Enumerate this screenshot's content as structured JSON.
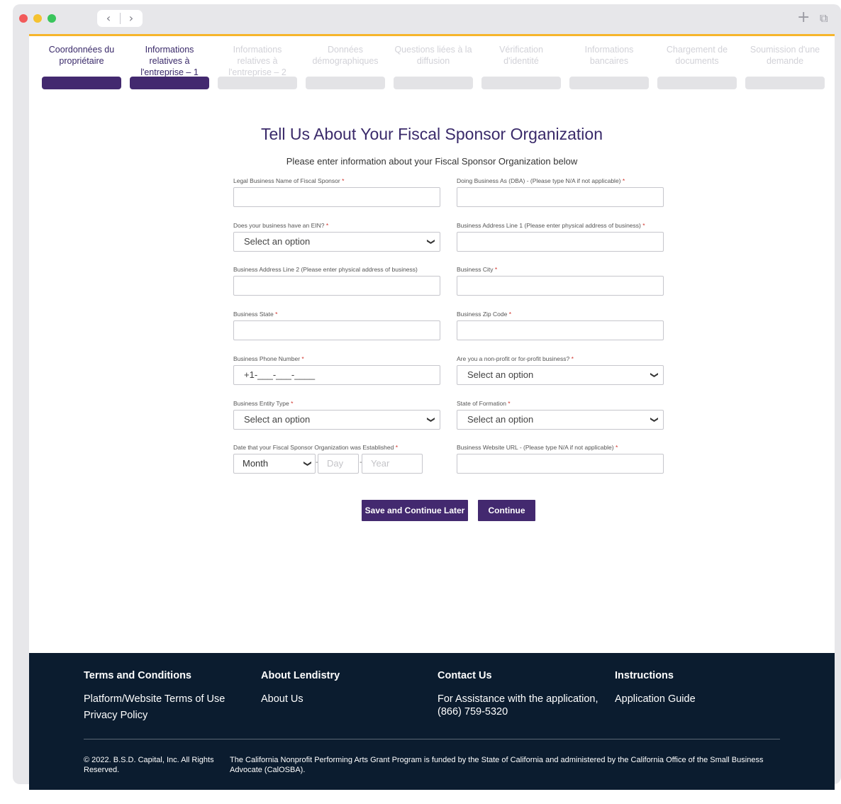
{
  "window": {
    "back_icon": "chevron-left-icon",
    "forward_icon": "chevron-right-icon",
    "new_tab_icon": "plus-icon",
    "tabs_icon": "tabs-overview-icon",
    "back_glyph": "‹",
    "forward_glyph": "›",
    "plus_glyph": "+",
    "tabs_glyph": "⧉"
  },
  "colors": {
    "accent": "#43296f",
    "progress_inactive": "#e3e3e6",
    "top_line": "#f6b52b",
    "footer_bg": "#0b1c2f",
    "required": "#d0342c"
  },
  "steps": [
    {
      "label": "Coordonnées du propriétaire",
      "active": true
    },
    {
      "label": "Informations relatives à l'entreprise – 1",
      "active": true
    },
    {
      "label": "Informations relatives à l'entreprise – 2",
      "active": false
    },
    {
      "label": "Données démographiques",
      "active": false
    },
    {
      "label": "Questions liées à la diffusion",
      "active": false
    },
    {
      "label": "Vérification d'identité",
      "active": false
    },
    {
      "label": "Informations bancaires",
      "active": false
    },
    {
      "label": "Chargement de documents",
      "active": false
    },
    {
      "label": "Soumission d'une demande",
      "active": false
    }
  ],
  "form": {
    "title": "Tell Us About Your Fiscal Sponsor Organization",
    "subtitle": "Please enter information about your Fiscal Sponsor Organization below",
    "required_marker": "*",
    "legal_name": {
      "label": "Legal Business Name of Fiscal Sponsor",
      "value": ""
    },
    "dba": {
      "label": "Doing Business As (DBA) - (Please type N/A if not applicable)",
      "value": ""
    },
    "ein": {
      "label": "Does your business have an EIN?",
      "value": "Select an option"
    },
    "address1": {
      "label": "Business Address Line 1 (Please enter physical address of business)",
      "value": ""
    },
    "address2": {
      "label": "Business Address Line 2 (Please enter physical address of business)",
      "value": ""
    },
    "city": {
      "label": "Business City",
      "value": ""
    },
    "state": {
      "label": "Business State",
      "value": ""
    },
    "zip": {
      "label": "Business Zip Code",
      "value": ""
    },
    "phone": {
      "label": "Business Phone Number",
      "value": "+1-___-___-____"
    },
    "profit_type": {
      "label": "Are you a non-profit or for-profit business?",
      "value": "Select an option"
    },
    "entity_type": {
      "label": "Business Entity Type",
      "value": "Select an option"
    },
    "formation_state": {
      "label": "State of Formation",
      "value": "Select an option"
    },
    "established": {
      "label": "Date that your Fiscal Sponsor Organization was Established",
      "month": "Month",
      "day_placeholder": "Day",
      "year_placeholder": "Year",
      "separator": "-"
    },
    "website": {
      "label": "Business Website URL - (Please type N/A if not applicable)",
      "value": ""
    },
    "chevron_icon": "chevron-down-icon",
    "chevron_glyph": "❯",
    "save_later_label": "Save and Continue Later",
    "continue_label": "Continue"
  },
  "footer": {
    "terms_heading": "Terms and Conditions",
    "terms_link": "Platform/Website Terms of Use",
    "privacy_link": "Privacy Policy",
    "about_heading": "About Lendistry",
    "about_link": "About Us",
    "contact_heading": "Contact Us",
    "contact_text": "For Assistance with the application, (866) 759-5320",
    "instructions_heading": "Instructions",
    "guide_link": "Application Guide",
    "copyright": "© 2022. B.S.D. Capital, Inc. All Rights Reserved.",
    "funding_note": "The California Nonprofit Performing Arts Grant Program is funded by the State of California and administered by the California Office of the Small Business Advocate (CalOSBA)."
  }
}
